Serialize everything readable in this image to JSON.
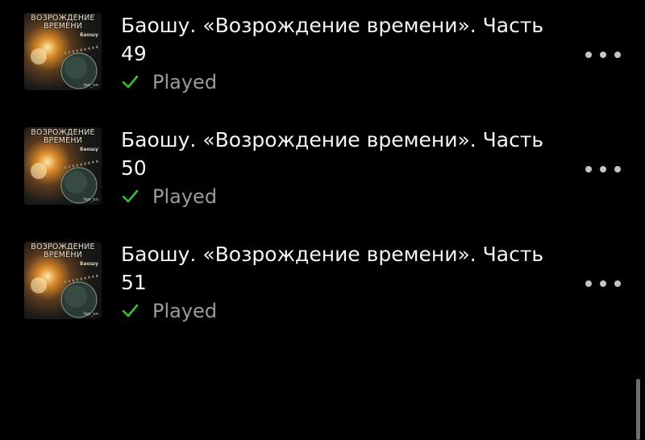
{
  "episodes": [
    {
      "title": "Баошу. «Возрождение времени». Часть 49",
      "status": "Played",
      "cover": {
        "title": "ВОЗРОЖДЕНИЕ ВРЕМЕНИ",
        "author": "Баошу",
        "brand": "fan_on"
      }
    },
    {
      "title": "Баошу. «Возрождение времени». Часть 50",
      "status": "Played",
      "cover": {
        "title": "ВОЗРОЖДЕНИЕ ВРЕМЕНИ",
        "author": "Баошу",
        "brand": "fan_on"
      }
    },
    {
      "title": "Баошу. «Возрождение времени». Часть 51",
      "status": "Played",
      "cover": {
        "title": "ВОЗРОЖДЕНИЕ ВРЕМЕНИ",
        "author": "Баошу",
        "brand": "fan_on"
      }
    }
  ],
  "icons": {
    "status": "check-icon",
    "more": "more-icon"
  },
  "colors": {
    "background": "#000000",
    "check": "#3dbb3d",
    "status_text": "#9a9a9a",
    "title": "#f4f4f4"
  }
}
